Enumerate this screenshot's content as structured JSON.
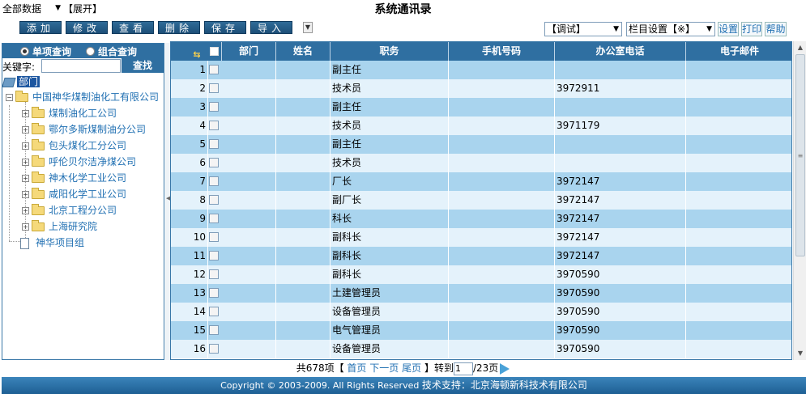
{
  "header": {
    "scope_select": "全部数据",
    "expand_link": "【展开】",
    "title": "系统通讯录"
  },
  "toolbar": {
    "add": "添加",
    "edit": "修改",
    "view": "查看",
    "delete": "删除",
    "save": "保存",
    "import": "导入",
    "mode_select": "【调试】",
    "column_select": "栏目设置【※】",
    "settings": "设置",
    "print": "打印",
    "help": "帮助"
  },
  "query": {
    "single_label": "单项查询",
    "combo_label": "组合查询",
    "keyword_label": "关键字:",
    "keyword_value": "",
    "search_button": "查找"
  },
  "tree": {
    "root": "部门",
    "company": "中国神华煤制油化工有限公司",
    "branches": [
      "煤制油化工公司",
      "鄂尔多斯煤制油分公司",
      "包头煤化工分公司",
      "呼伦贝尔洁净煤公司",
      "神木化学工业公司",
      "咸阳化学工业公司",
      "北京工程分公司",
      "上海研究院"
    ],
    "project": "神华项目组"
  },
  "table": {
    "columns": [
      "部门",
      "姓名",
      "职务",
      "手机号码",
      "办公室电话",
      "电子邮件"
    ],
    "rows": [
      {
        "n": "1",
        "dept": "",
        "name": "",
        "title": "副主任",
        "mobile": "",
        "office": "",
        "email": ""
      },
      {
        "n": "2",
        "dept": "",
        "name": "",
        "title": "技术员",
        "mobile": "",
        "office": "3972911",
        "email": ""
      },
      {
        "n": "3",
        "dept": "",
        "name": "",
        "title": "副主任",
        "mobile": "",
        "office": "",
        "email": ""
      },
      {
        "n": "4",
        "dept": "",
        "name": "",
        "title": "技术员",
        "mobile": "",
        "office": "3971179",
        "email": ""
      },
      {
        "n": "5",
        "dept": "",
        "name": "",
        "title": "副主任",
        "mobile": "",
        "office": "",
        "email": ""
      },
      {
        "n": "6",
        "dept": "",
        "name": "",
        "title": "技术员",
        "mobile": "",
        "office": "",
        "email": ""
      },
      {
        "n": "7",
        "dept": "",
        "name": "",
        "title": "厂长",
        "mobile": "",
        "office": "3972147",
        "email": ""
      },
      {
        "n": "8",
        "dept": "",
        "name": "",
        "title": "副厂长",
        "mobile": "",
        "office": "3972147",
        "email": ""
      },
      {
        "n": "9",
        "dept": "",
        "name": "",
        "title": "科长",
        "mobile": "",
        "office": "3972147",
        "email": ""
      },
      {
        "n": "10",
        "dept": "",
        "name": "",
        "title": "副科长",
        "mobile": "",
        "office": "3972147",
        "email": ""
      },
      {
        "n": "11",
        "dept": "",
        "name": "",
        "title": "副科长",
        "mobile": "",
        "office": "3972147",
        "email": ""
      },
      {
        "n": "12",
        "dept": "",
        "name": "",
        "title": "副科长",
        "mobile": "",
        "office": "3970590",
        "email": ""
      },
      {
        "n": "13",
        "dept": "",
        "name": "",
        "title": "土建管理员",
        "mobile": "",
        "office": "3970590",
        "email": ""
      },
      {
        "n": "14",
        "dept": "",
        "name": "",
        "title": "设备管理员",
        "mobile": "",
        "office": "3970590",
        "email": ""
      },
      {
        "n": "15",
        "dept": "",
        "name": "",
        "title": "电气管理员",
        "mobile": "",
        "office": "3970590",
        "email": ""
      },
      {
        "n": "16",
        "dept": "",
        "name": "",
        "title": "设备管理员",
        "mobile": "",
        "office": "3970590",
        "email": ""
      }
    ]
  },
  "pager": {
    "total": "共678项【",
    "first": "首页",
    "next": "下一页",
    "last": "尾页",
    "goto": "】转到",
    "page_value": "1",
    "pages": "/23页"
  },
  "footer": {
    "copyright": "Copyright © 2003-2009. All Rights Reserved ",
    "support": "技术支持：北京海顿新科技术有限公司"
  },
  "colors": {
    "header_blue": "#2f6fa1",
    "row_odd": "#a9d4ee",
    "row_even": "#e4f2fb",
    "link_blue": "#1f6fb2"
  }
}
